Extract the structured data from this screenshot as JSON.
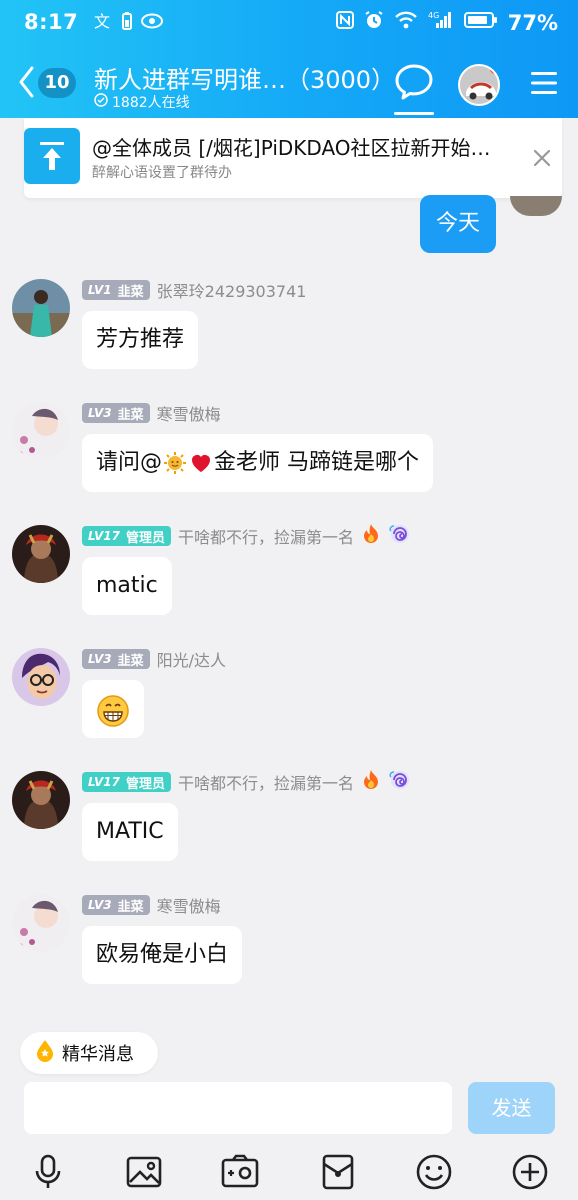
{
  "status": {
    "time": "8:17",
    "battery": "77%",
    "network": "4G"
  },
  "header": {
    "back_count": "10",
    "title": "新人进群写明谁…（3000）",
    "online": "1882人在线"
  },
  "announcement": {
    "title": "@全体成员 [/烟花]PiDKDAO社区拉新开始…",
    "subtitle": "醉解心语设置了群待办"
  },
  "today_label": "今天",
  "messages": [
    {
      "level": "LV1",
      "role": "韭菜",
      "badge_color": "#a7aab8",
      "nick": "张翠玲2429303741",
      "text": "芳方推荐"
    },
    {
      "level": "LV3",
      "role": "韭菜",
      "badge_color": "#a7aab8",
      "nick": "寒雪傲梅",
      "text_prefix": "请问@",
      "text_suffix": "金老师 马蹄链是哪个"
    },
    {
      "level": "LV17",
      "role": "管理员",
      "badge_color": "#40d0c6",
      "nick": "干啥都不行，捡漏第一名",
      "text": "matic"
    },
    {
      "level": "LV3",
      "role": "韭菜",
      "badge_color": "#a7aab8",
      "nick": "阳光/达人",
      "text": ""
    },
    {
      "level": "LV17",
      "role": "管理员",
      "badge_color": "#40d0c6",
      "nick": "干啥都不行，捡漏第一名",
      "text": "MATIC"
    },
    {
      "level": "LV3",
      "role": "韭菜",
      "badge_color": "#a7aab8",
      "nick": "寒雪傲梅",
      "text": "欧易俺是小白"
    }
  ],
  "essence_label": "精华消息",
  "input": {
    "placeholder": "",
    "send_label": "发送"
  },
  "toolbar_icons": [
    "microphone-icon",
    "image-icon",
    "camera-icon",
    "red-packet-icon",
    "emoji-icon",
    "plus-icon"
  ],
  "colors": {
    "accent": "#1b9cf5",
    "header_start": "#22c4f6",
    "header_end": "#0e98f5"
  }
}
